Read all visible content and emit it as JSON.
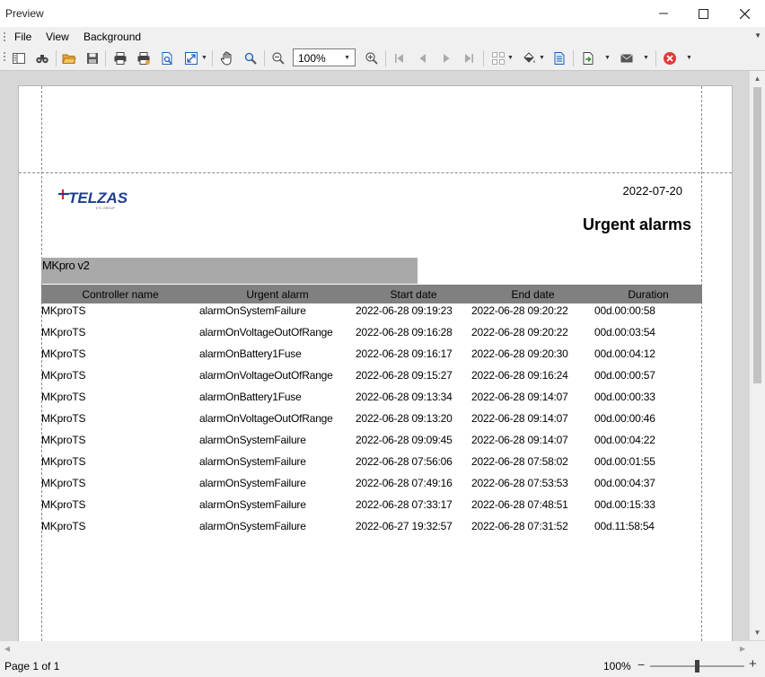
{
  "window": {
    "title": "Preview"
  },
  "menu": {
    "items": [
      "File",
      "View",
      "Background"
    ]
  },
  "toolbar": {
    "zoom_value": "100%",
    "icons": [
      "navigation-pane-icon",
      "find-icon",
      "open-icon",
      "save-icon",
      "print-icon",
      "quick-print-icon",
      "page-setup-icon",
      "scale-icon",
      "hand-tool-icon",
      "magnifier-icon",
      "zoom-out-icon",
      "zoom-in-icon",
      "first-page-icon",
      "previous-page-icon",
      "next-page-icon",
      "last-page-icon",
      "multiple-pages-icon",
      "fill-background-icon",
      "watermark-icon",
      "export-icon",
      "send-email-icon",
      "close-preview-icon"
    ]
  },
  "report": {
    "logo_text": "TELZAS",
    "logo_subtext": "ETC GROUP",
    "date": "2022-07-20",
    "title": "Urgent alarms",
    "group": "MKpro v2",
    "columns": [
      "Controller name",
      "Urgent alarm",
      "Start date",
      "End date",
      "Duration"
    ],
    "rows": [
      [
        "MKproTS",
        "alarmOnSystemFailure",
        "2022-06-28 09:19:23",
        "2022-06-28 09:20:22",
        "00d.00:00:58"
      ],
      [
        "MKproTS",
        "alarmOnVoltageOutOfRange",
        "2022-06-28 09:16:28",
        "2022-06-28 09:20:22",
        "00d.00:03:54"
      ],
      [
        "MKproTS",
        "alarmOnBattery1Fuse",
        "2022-06-28 09:16:17",
        "2022-06-28 09:20:30",
        "00d.00:04:12"
      ],
      [
        "MKproTS",
        "alarmOnVoltageOutOfRange",
        "2022-06-28 09:15:27",
        "2022-06-28 09:16:24",
        "00d.00:00:57"
      ],
      [
        "MKproTS",
        "alarmOnBattery1Fuse",
        "2022-06-28 09:13:34",
        "2022-06-28 09:14:07",
        "00d.00:00:33"
      ],
      [
        "MKproTS",
        "alarmOnVoltageOutOfRange",
        "2022-06-28 09:13:20",
        "2022-06-28 09:14:07",
        "00d.00:00:46"
      ],
      [
        "MKproTS",
        "alarmOnSystemFailure",
        "2022-06-28 09:09:45",
        "2022-06-28 09:14:07",
        "00d.00:04:22"
      ],
      [
        "MKproTS",
        "alarmOnSystemFailure",
        "2022-06-28 07:56:06",
        "2022-06-28 07:58:02",
        "00d.00:01:55"
      ],
      [
        "MKproTS",
        "alarmOnSystemFailure",
        "2022-06-28 07:49:16",
        "2022-06-28 07:53:53",
        "00d.00:04:37"
      ],
      [
        "MKproTS",
        "alarmOnSystemFailure",
        "2022-06-28 07:33:17",
        "2022-06-28 07:48:51",
        "00d.00:15:33"
      ],
      [
        "MKproTS",
        "alarmOnSystemFailure",
        "2022-06-27 19:32:57",
        "2022-06-28 07:31:52",
        "00d.11:58:54"
      ]
    ]
  },
  "status": {
    "page_info": "Page 1 of 1",
    "zoom": "100%",
    "zoom_level_percent": 100
  },
  "colors": {
    "logo_blue": "#1e3f8f",
    "logo_red": "#d9232e",
    "group_header_bg": "#a9a9a9",
    "column_header_bg": "#808080",
    "close_preview_red": "#e03a3a"
  }
}
